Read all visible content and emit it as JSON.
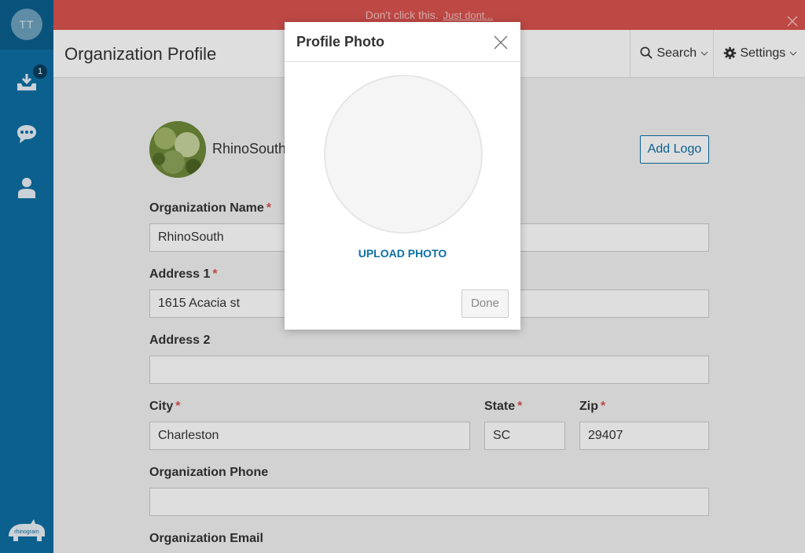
{
  "sidebar": {
    "avatar_initials": "TT",
    "inbox_badge": "1",
    "icons": [
      "inbox-icon",
      "chat-icon",
      "contact-icon"
    ],
    "brand_color": "#0d6fa4"
  },
  "banner": {
    "text": "Don't click this.",
    "link": "Just dont...",
    "color": "#d9534f"
  },
  "header": {
    "title": "Organization Profile",
    "search_label": "Search",
    "settings_label": "Settings"
  },
  "profile": {
    "org_display_name": "RhinoSouth",
    "add_logo_label": "Add Logo"
  },
  "form": {
    "org_name_label": "Organization Name",
    "org_name_value": "RhinoSouth",
    "address1_label": "Address 1",
    "address1_value": "1615 Acacia st",
    "address2_label": "Address 2",
    "address2_value": "",
    "city_label": "City",
    "city_value": "Charleston",
    "state_label": "State",
    "state_value": "SC",
    "zip_label": "Zip",
    "zip_value": "29407",
    "phone_label": "Organization Phone",
    "phone_value": "",
    "email_label": "Organization Email",
    "required_mark": "*"
  },
  "modal": {
    "title": "Profile Photo",
    "upload_label": "UPLOAD PHOTO",
    "done_label": "Done"
  }
}
